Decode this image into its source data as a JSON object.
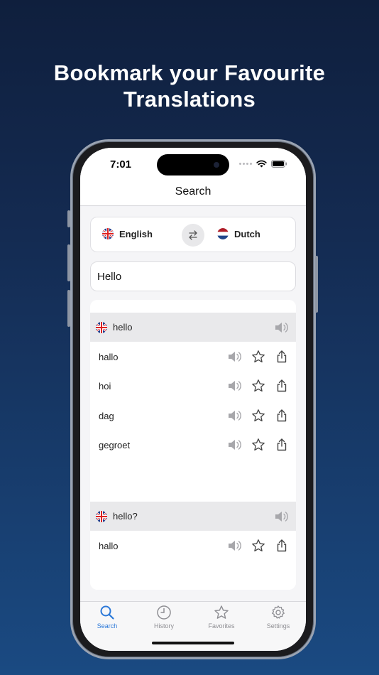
{
  "headline": {
    "line1": "Bookmark your Favourite",
    "line2": "Translations"
  },
  "status": {
    "time": "7:01"
  },
  "nav": {
    "title": "Search"
  },
  "languages": {
    "source": "English",
    "target": "Dutch",
    "source_flag": "uk-flag-icon",
    "target_flag": "nl-flag-icon"
  },
  "search": {
    "value": "Hello"
  },
  "groups": [
    {
      "term": "hello",
      "translations": [
        "hallo",
        "hoi",
        "dag",
        "gegroet"
      ]
    },
    {
      "term": "hello?",
      "translations": [
        "hallo"
      ]
    }
  ],
  "tabs": [
    {
      "label": "Search",
      "icon": "search-icon",
      "active": true
    },
    {
      "label": "History",
      "icon": "clock-icon",
      "active": false
    },
    {
      "label": "Favorites",
      "icon": "star-icon",
      "active": false
    },
    {
      "label": "Settings",
      "icon": "gear-icon",
      "active": false
    }
  ],
  "colors": {
    "accent": "#2b78d8",
    "background_top": "#0f1f3d",
    "background_bottom": "#1a4a82"
  }
}
